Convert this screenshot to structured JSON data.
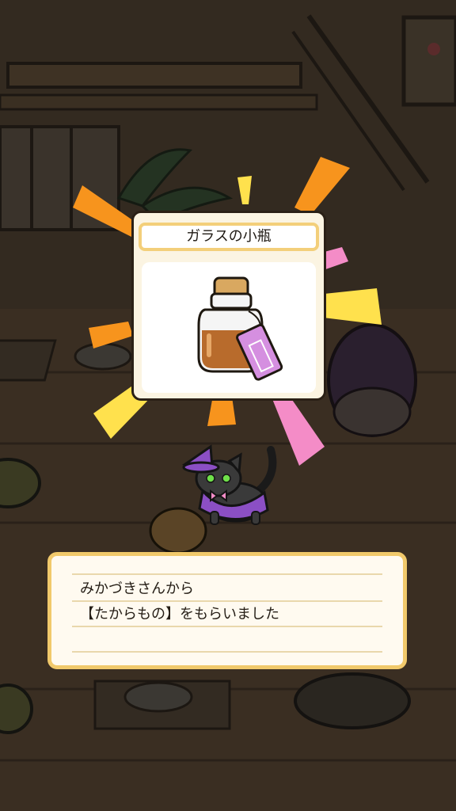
{
  "item": {
    "name": "ガラスの小瓶"
  },
  "message": {
    "line1": "みかづきさんから",
    "line2": "【たからもの】をもらいました"
  },
  "colors": {
    "ray_orange": "#f7941d",
    "ray_yellow": "#ffe14d",
    "ray_pink": "#f48cc7",
    "card_border": "#f3cf7a",
    "witch_hat": "#8b4fc4"
  },
  "icons": {
    "treasure": "glass-bottle-with-cork-and-tag",
    "cat": "black-cat-witch-hat"
  }
}
